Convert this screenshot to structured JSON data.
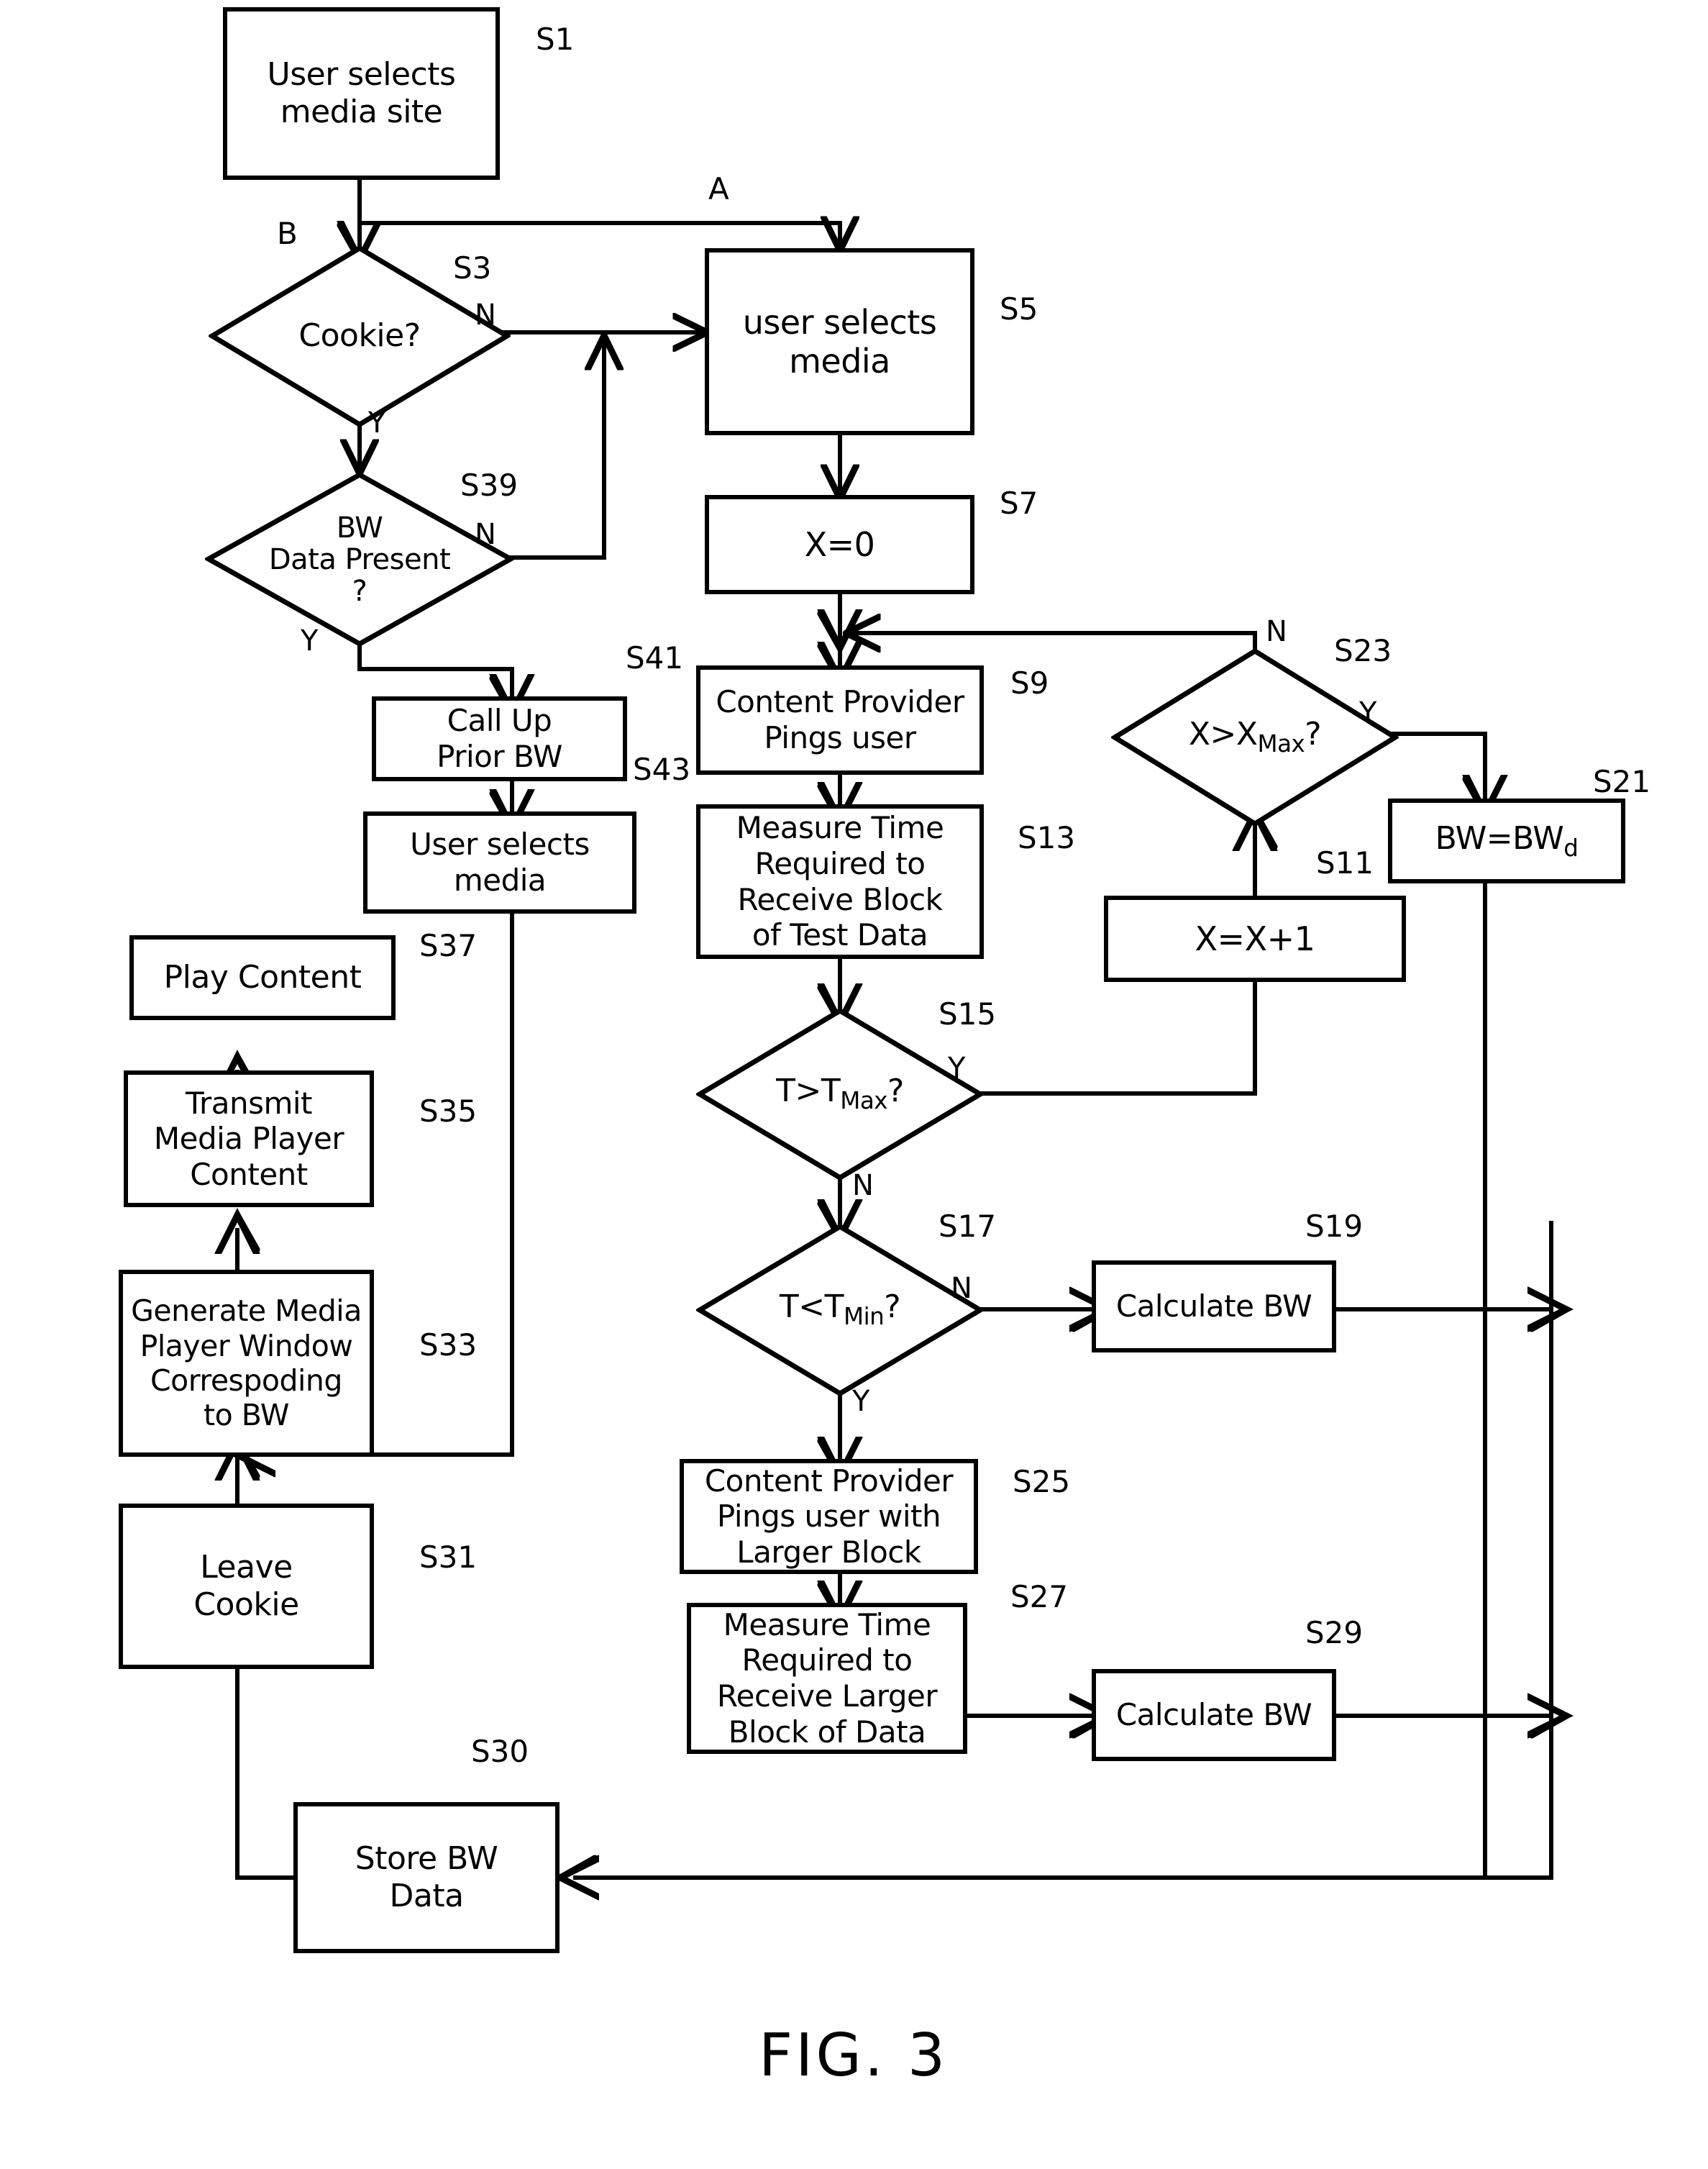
{
  "figure": {
    "caption": "FIG. 3",
    "type": "patent-flowchart"
  },
  "connectors": {
    "a": "A",
    "b": "B"
  },
  "nodes": [
    {
      "id": "S1",
      "ref": "S1",
      "shape": "process",
      "text": "User selects\nmedia site"
    },
    {
      "id": "S3",
      "ref": "S3",
      "shape": "decision",
      "text": "Cookie?"
    },
    {
      "id": "S39",
      "ref": "S39",
      "shape": "decision",
      "text": "BW\nData Present\n?"
    },
    {
      "id": "S41",
      "ref": "S41",
      "shape": "process",
      "text": "Call Up\nPrior BW"
    },
    {
      "id": "S43",
      "ref": "S43",
      "shape": "process",
      "text": "User selects\nmedia"
    },
    {
      "id": "S5",
      "ref": "S5",
      "shape": "process",
      "text": "user selects\nmedia"
    },
    {
      "id": "S7",
      "ref": "S7",
      "shape": "process",
      "text": "X=0"
    },
    {
      "id": "S9",
      "ref": "S9",
      "shape": "process",
      "text": "Content Provider\nPings user"
    },
    {
      "id": "S13",
      "ref": "S13",
      "shape": "process",
      "text": "Measure Time\nRequired to\nReceive Block\nof Test Data"
    },
    {
      "id": "S15",
      "ref": "S15",
      "shape": "decision",
      "text": "T>T Max?"
    },
    {
      "id": "S17",
      "ref": "S17",
      "shape": "decision",
      "text": "T<T Min?"
    },
    {
      "id": "S23",
      "ref": "S23",
      "shape": "decision",
      "text": "X>X Max?"
    },
    {
      "id": "S11",
      "ref": "S11",
      "shape": "process",
      "text": "X=X+1"
    },
    {
      "id": "S21",
      "ref": "S21",
      "shape": "process",
      "text": "BW=BW d"
    },
    {
      "id": "S19",
      "ref": "S19",
      "shape": "process",
      "text": "Calculate BW"
    },
    {
      "id": "S25",
      "ref": "S25",
      "shape": "process",
      "text": "Content Provider\nPings user with\nLarger Block"
    },
    {
      "id": "S27",
      "ref": "S27",
      "shape": "process",
      "text": "Measure Time\nRequired to\nReceive Larger\nBlock of Data"
    },
    {
      "id": "S29",
      "ref": "S29",
      "shape": "process",
      "text": "Calculate BW"
    },
    {
      "id": "S30",
      "ref": "S30",
      "shape": "process",
      "text": "Store BW\nData"
    },
    {
      "id": "S31",
      "ref": "S31",
      "shape": "process",
      "text": "Leave\nCookie"
    },
    {
      "id": "S33",
      "ref": "S33",
      "shape": "process",
      "text": "Generate Media\nPlayer Window\nCorrespoding\nto BW"
    },
    {
      "id": "S35",
      "ref": "S35",
      "shape": "process",
      "text": "Transmit\nMedia Player\nContent"
    },
    {
      "id": "S37",
      "ref": "S37",
      "shape": "process",
      "text": "Play Content"
    }
  ],
  "branch_labels": {
    "s3_no": "N",
    "s3_yes": "Y",
    "s39_no": "N",
    "s39_yes": "Y",
    "s15_yes": "Y",
    "s15_no": "N",
    "s17_no": "N",
    "s17_yes": "Y",
    "s23_no": "N",
    "s23_yes": "Y"
  },
  "colors": {
    "stroke": "#000000",
    "fill": "#ffffff"
  }
}
